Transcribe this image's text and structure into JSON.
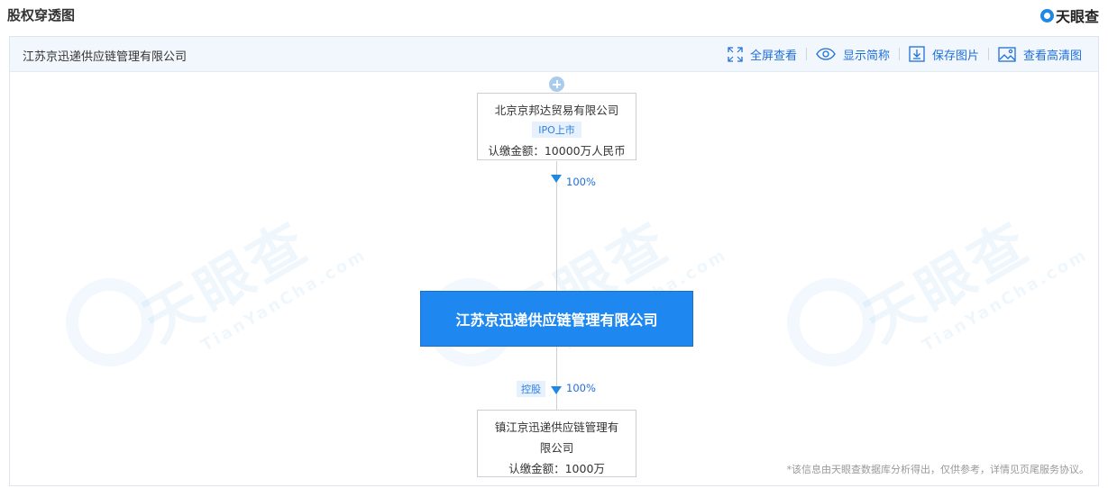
{
  "page_title": "股权穿透图",
  "brand": "天眼查",
  "header": {
    "company_name": "江苏京迅递供应链管理有限公司"
  },
  "toolbar": {
    "fullscreen": "全屏查看",
    "show_short": "显示简称",
    "save_image": "保存图片",
    "hd_image": "查看高清图"
  },
  "watermark": {
    "cn": "天眼查",
    "en": "TianYanCha.com"
  },
  "shareholder": {
    "name": "北京京邦达贸易有限公司",
    "tag": "IPO上市",
    "amount": "认缴金额：10000万人民币",
    "percent": "100%"
  },
  "main_company": {
    "name": "江苏京迅递供应链管理有限公司"
  },
  "subsidiary": {
    "name_line1": "镇江京迅递供应链管理有",
    "name_line2": "限公司",
    "amount": "认缴金额：1000万",
    "percent": "100%",
    "control_tag": "控股"
  },
  "disclaimer": "*该信息由天眼查数据库分析得出，仅供参考，详情见页尾服务协议。",
  "colors": {
    "accent": "#1e88f0",
    "link": "#1e6fd9",
    "tag_bg": "#e6f1fd"
  },
  "icons": [
    "expand-icon",
    "eye-icon",
    "download-icon",
    "image-icon",
    "plus-icon",
    "arrow-down-icon"
  ]
}
